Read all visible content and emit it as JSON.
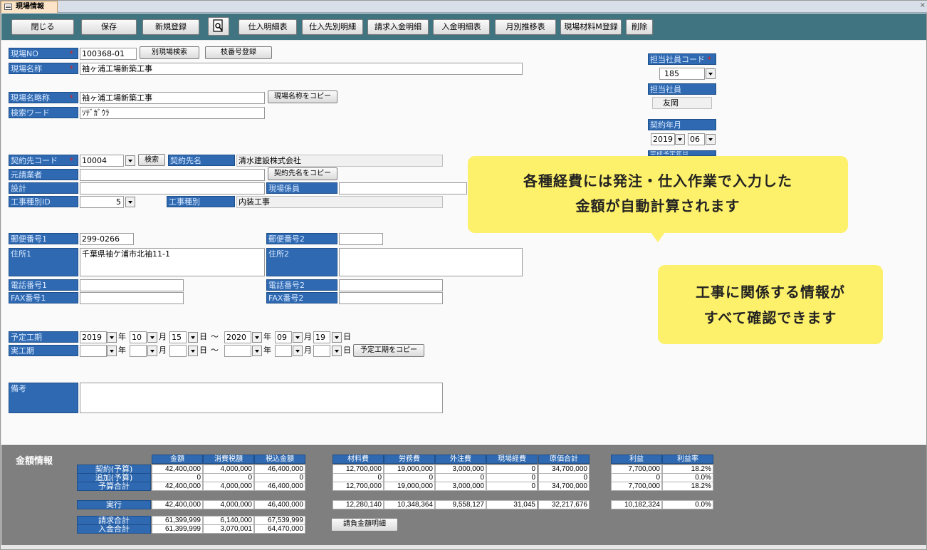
{
  "window": {
    "tab_title": "現場情報",
    "close_glyph": "×"
  },
  "toolbar": {
    "close": "閉じる",
    "save": "保存",
    "new": "新規登録",
    "btn_purchase_detail": "仕入明細表",
    "btn_vendor_detail": "仕入先別明細",
    "btn_invoice_receipt": "請求入金明細",
    "btn_receipt_detail": "入金明細表",
    "btn_monthly": "月別推移表",
    "btn_material_reg": "現場材料M登録",
    "btn_delete": "削除"
  },
  "form": {
    "site_no_label": "現場NO",
    "site_no": "100368-01",
    "btn_other_site_search": "別現場検索",
    "btn_branch_reg": "枝番号登録",
    "site_name_label": "現場名称",
    "site_name": "袖ヶ浦工場新築工事",
    "site_short_label": "現場名略称",
    "site_short": "袖ヶ浦工場新築工事",
    "btn_copy_site_name": "現場名称をコピー",
    "search_word_label": "検索ワード",
    "search_word": "ｿﾃﾞｶﾞｳﾗ",
    "contract_code_label": "契約先コード",
    "contract_code": "10004",
    "btn_search": "検索",
    "contract_name_label": "契約先名",
    "contract_name": "清水建設株式会社",
    "prime_label": "元請業者",
    "btn_copy_contract": "契約先名をコピー",
    "design_label": "設計",
    "site_staff_label": "現場係員",
    "work_type_id_label": "工事種別ID",
    "work_type_id": "5",
    "work_type_label": "工事種別",
    "work_type": "内装工事",
    "zip1_label": "郵便番号1",
    "zip1": "299-0266",
    "zip2_label": "郵便番号2",
    "addr1_label": "住所1",
    "addr1": "千葉県袖ケ浦市北袖11-1",
    "addr2_label": "住所2",
    "tel1_label": "電話番号1",
    "tel2_label": "電話番号2",
    "fax1_label": "FAX番号1",
    "fax2_label": "FAX番号2",
    "planned_label": "予定工期",
    "actual_label": "実工期",
    "plan_y1": "2019",
    "plan_m1": "10",
    "plan_d1": "15",
    "plan_y2": "2020",
    "plan_m2": "09",
    "plan_d2": "19",
    "u_year": "年",
    "u_month": "月",
    "u_day": "日",
    "tilde": "～",
    "btn_copy_planned": "予定工期をコピー",
    "remarks_label": "備考"
  },
  "side": {
    "staff_code_label": "担当社員コード",
    "staff_code": "185",
    "staff_label": "担当社員",
    "staff": "友岡",
    "contract_month_label": "契約年月",
    "contract_year": "2019",
    "contract_month": "06",
    "hidden_label": "完成予定年月"
  },
  "callouts": {
    "top_line1": "各種経費には発注・仕入作業で入力した",
    "top_line2": "金額が自動計算されます",
    "bottom_line1": "工事に関係する情報が",
    "bottom_line2": "すべて確認できます"
  },
  "money": {
    "title": "金額情報",
    "headers_a": [
      "金額",
      "消費税額",
      "税込金額"
    ],
    "headers_b": [
      "材料費",
      "労務費",
      "外注費",
      "現場経費",
      "原価合計"
    ],
    "headers_c": [
      "利益",
      "利益率"
    ],
    "row_labels": [
      "契約(予算)",
      "追加(予算)",
      "予算合計",
      "実行",
      "請求合計",
      "入金合計"
    ],
    "rows_a": [
      [
        "42,400,000",
        "4,000,000",
        "46,400,000"
      ],
      [
        "0",
        "0",
        "0"
      ],
      [
        "42,400,000",
        "4,000,000",
        "46,400,000"
      ],
      [
        "42,400,000",
        "4,000,000",
        "46,400,000"
      ],
      [
        "61,399,999",
        "6,140,000",
        "67,539,999"
      ],
      [
        "61,399,999",
        "3,070,001",
        "64,470,000"
      ]
    ],
    "rows_b": [
      [
        "12,700,000",
        "19,000,000",
        "3,000,000",
        "0",
        "34,700,000"
      ],
      [
        "0",
        "0",
        "0",
        "0",
        "0"
      ],
      [
        "12,700,000",
        "19,000,000",
        "3,000,000",
        "0",
        "34,700,000"
      ],
      [
        "12,280,140",
        "10,348,364",
        "9,558,127",
        "31,045",
        "32,217,676"
      ]
    ],
    "rows_c": [
      [
        "7,700,000",
        "18.2%"
      ],
      [
        "0",
        "0.0%"
      ],
      [
        "7,700,000",
        "18.2%"
      ],
      [
        "10,182,324",
        "0.0%"
      ]
    ],
    "btn_contract_detail": "請負金額明細"
  }
}
